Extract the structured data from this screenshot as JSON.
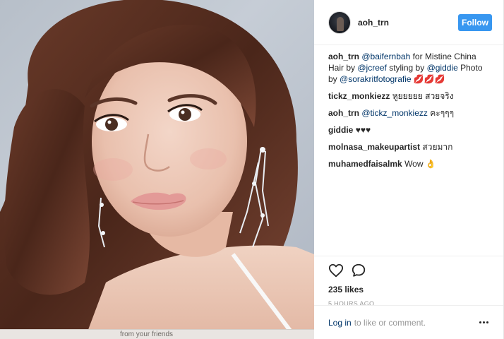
{
  "post": {
    "username": "aoh_trn",
    "follow_label": "Follow",
    "likes": "235 likes",
    "timestamp": "5 HOURS AGO",
    "login_link": "Log in",
    "login_suffix": "to like or comment.",
    "bottom_strip_text": "from your friends"
  },
  "caption": {
    "author": "aoh_trn",
    "parts": [
      {
        "type": "mention",
        "text": "@baifernbah"
      },
      {
        "type": "text",
        "text": " for Mistine China Hair by "
      },
      {
        "type": "mention",
        "text": "@jcreef"
      },
      {
        "type": "text",
        "text": " styling by "
      },
      {
        "type": "mention",
        "text": "@giddie"
      },
      {
        "type": "text",
        "text": " Photo by "
      },
      {
        "type": "mention",
        "text": "@sorakritfotografie"
      },
      {
        "type": "text",
        "text": " 💋💋💋"
      }
    ]
  },
  "comments": [
    {
      "author": "tickz_monkiezz",
      "text": "หูยยยยย สวยจริง"
    },
    {
      "author": "aoh_trn",
      "mention": "@tickz_monkiezz",
      "text": "คะๆๆๆ"
    },
    {
      "author": "giddie",
      "text": "♥♥♥"
    },
    {
      "author": "molnasa_makeupartist",
      "text": "สวยมาก"
    },
    {
      "author": "muhamedfaisalmk",
      "text": "Wow 👌"
    }
  ],
  "icons": {
    "like": "heart-icon",
    "comment": "comment-bubble-icon",
    "more": "more-options-icon"
  },
  "colors": {
    "follow_button": "#3897f0",
    "mention": "#003569"
  }
}
